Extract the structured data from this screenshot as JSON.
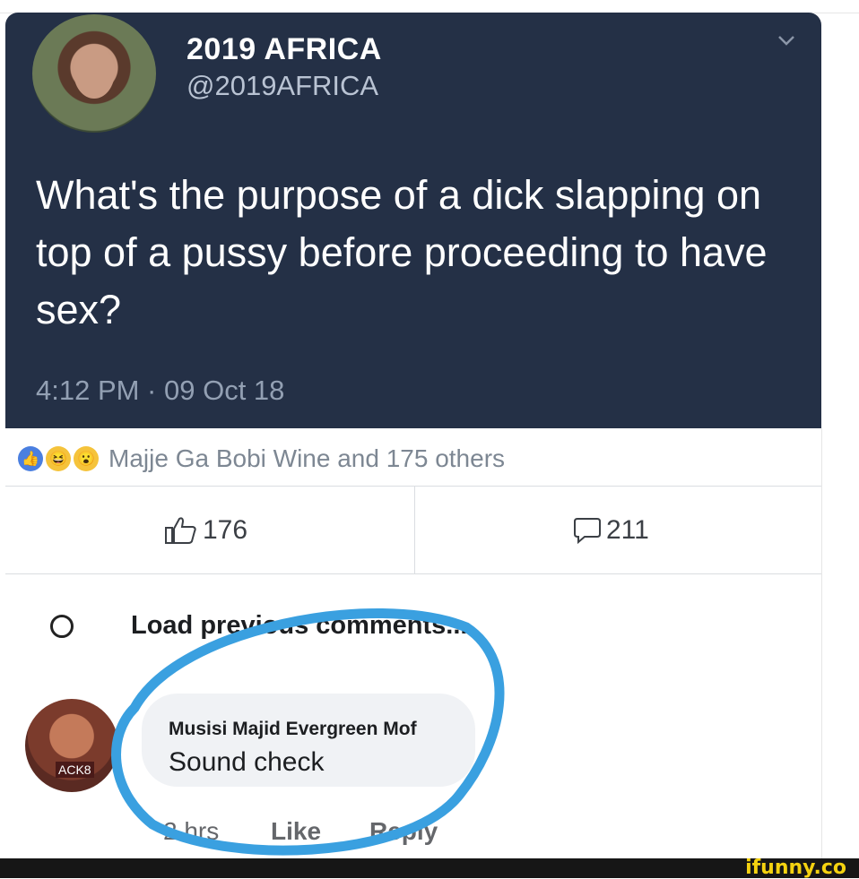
{
  "tweet": {
    "display_name": "2019 AFRICA",
    "handle": "@2019AFRICA",
    "text": "What's the purpose of a dick slapping on top of a pussy before proceeding to have sex?",
    "timestamp": "4:12 PM · 09 Oct 18",
    "chevron_icon": "chevron-down-icon",
    "colors": {
      "background": "#243046",
      "text": "#ffffff",
      "muted": "#93a0b3"
    }
  },
  "post": {
    "reactions_summary": "Majje Ga Bobi Wine and 175 others",
    "reaction_icons": [
      "like-reaction-icon",
      "haha-reaction-icon",
      "wow-reaction-icon"
    ],
    "likes_count": "176",
    "comments_count": "211"
  },
  "comments": {
    "load_previous_label": "Load previous comments...",
    "items": [
      {
        "author": "Musisi Majid Evergreen Mof",
        "text": "Sound check",
        "time": "2 hrs",
        "like_label": "Like",
        "reply_label": "Reply",
        "avatar_tag": "ACK8"
      }
    ]
  },
  "annotation": {
    "color": "#3aa0e0"
  },
  "watermark": {
    "brand": "ifunny.co"
  }
}
